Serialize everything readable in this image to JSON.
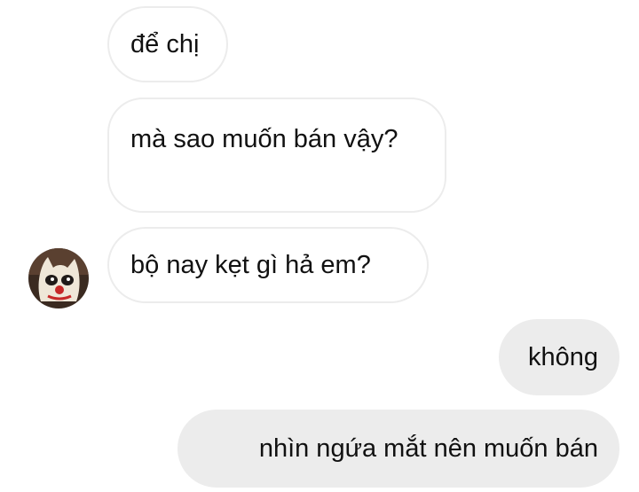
{
  "conversation": {
    "messages": [
      {
        "sender": "other",
        "text": "để chị"
      },
      {
        "sender": "other",
        "text": "mà sao muốn bán vậy?"
      },
      {
        "sender": "other",
        "text": "bộ nay kẹt gì hả em?"
      },
      {
        "sender": "me",
        "text": "không"
      },
      {
        "sender": "me",
        "text": "nhìn ngứa mắt nên muốn bán"
      }
    ],
    "avatar": {
      "icon": "clown-cat-avatar-icon"
    },
    "colors": {
      "incoming_bubble_bg": "#ffffff",
      "incoming_bubble_border": "#ececec",
      "outgoing_bubble_bg": "#ececec",
      "text": "#111111"
    }
  }
}
